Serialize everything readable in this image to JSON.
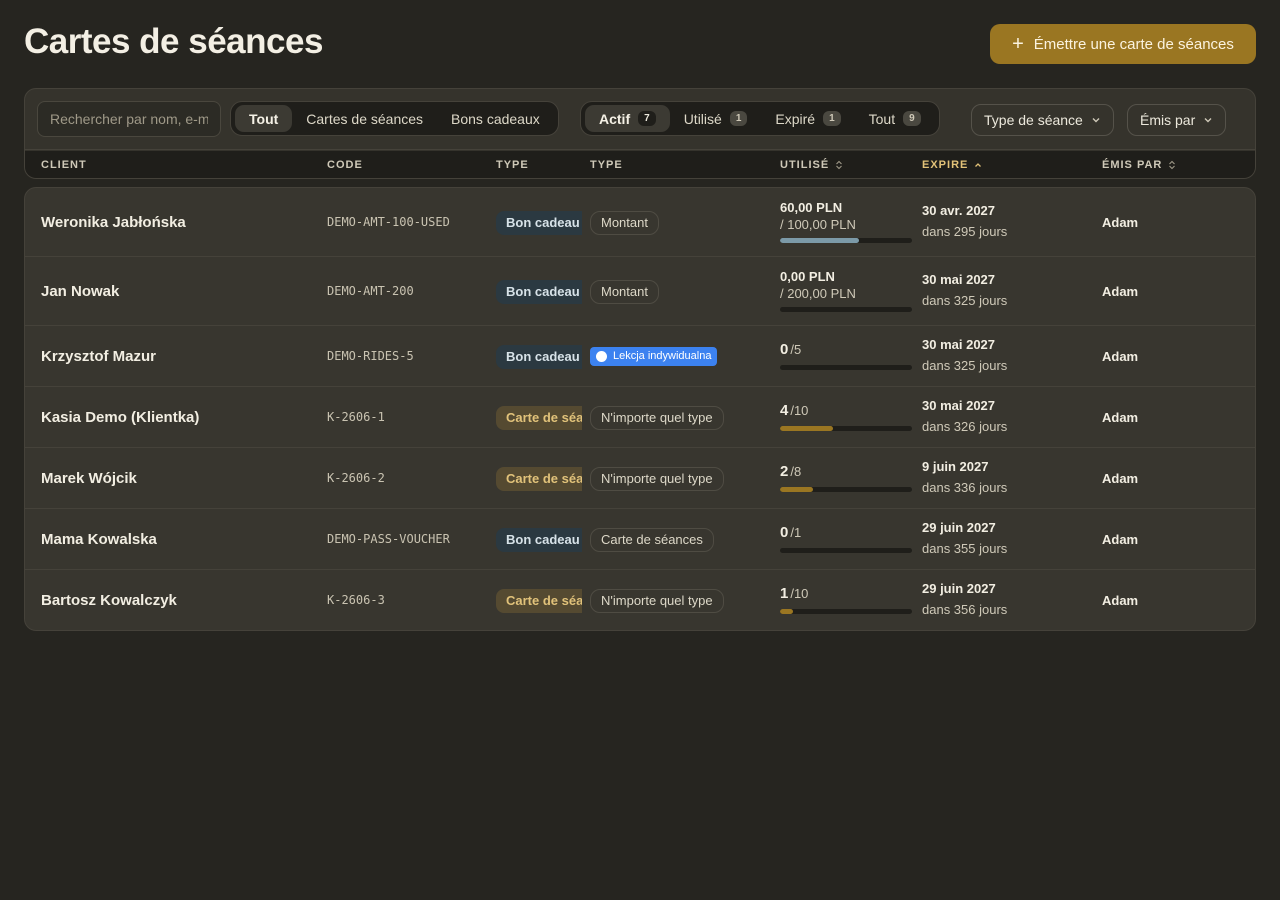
{
  "page": {
    "title": "Cartes de séances"
  },
  "actions": {
    "issue_label": "Émettre une carte de séances"
  },
  "toolbar": {
    "search_placeholder": "Rechercher par nom, e-mail ou code",
    "kind_filters": [
      {
        "label": "Tout",
        "active": true
      },
      {
        "label": "Cartes de séances",
        "active": false
      },
      {
        "label": "Bons cadeaux",
        "active": false
      }
    ],
    "status_filters": [
      {
        "label": "Actif",
        "count": "7",
        "active": true
      },
      {
        "label": "Utilisé",
        "count": "1",
        "active": false
      },
      {
        "label": "Expiré",
        "count": "1",
        "active": false
      },
      {
        "label": "Tout",
        "count": "9",
        "active": false
      }
    ],
    "session_type_dropdown": "Type de séance",
    "issued_by_dropdown": "Émis par"
  },
  "columns": {
    "client": "CLIENT",
    "code": "CODE",
    "type": "TYPE",
    "session_type": "TYPE",
    "used": "UTILISÉ",
    "expires": "EXPIRE",
    "issued_by": "ÉMIS PAR"
  },
  "colors": {
    "accent": "#9a7622",
    "bar_amount": "#7c9aa8",
    "bar_sessions": "#9a7622",
    "lesson": "#3c82f0"
  },
  "rows": [
    {
      "client": "Weronika Jabłońska",
      "code": "DEMO-AMT-100-USED",
      "kind": "gift",
      "type": "Bon cadeau",
      "session_type": "Montant",
      "session_style": "outline",
      "used_mode": "amount",
      "used_value": "60,00 PLN",
      "used_total": "/ 100,00 PLN",
      "progress": 0.6,
      "expires": "30 avr. 2027",
      "expires_rel": "dans 295 jours",
      "issuer": "Adam"
    },
    {
      "client": "Jan Nowak",
      "code": "DEMO-AMT-200",
      "kind": "gift",
      "type": "Bon cadeau",
      "session_type": "Montant",
      "session_style": "outline",
      "used_mode": "amount",
      "used_value": "0,00 PLN",
      "used_total": "/ 200,00 PLN",
      "progress": 0,
      "expires": "30 mai 2027",
      "expires_rel": "dans 325 jours",
      "issuer": "Adam"
    },
    {
      "client": "Krzysztof Mazur",
      "code": "DEMO-RIDES-5",
      "kind": "gift",
      "type": "Bon cadeau",
      "session_type": "Lekcja indywidualna",
      "session_style": "lesson",
      "used_mode": "count",
      "used_value": "0",
      "used_total": "/5",
      "progress": 0,
      "expires": "30 mai 2027",
      "expires_rel": "dans 325 jours",
      "issuer": "Adam"
    },
    {
      "client": "Kasia Demo (Klientka)",
      "code": "K-2606-1",
      "kind": "pass",
      "type": "Carte de séances",
      "session_type": "N'importe quel type",
      "session_style": "outline",
      "used_mode": "count",
      "used_value": "4",
      "used_total": "/10",
      "progress": 0.4,
      "expires": "30 mai 2027",
      "expires_rel": "dans 326 jours",
      "issuer": "Adam"
    },
    {
      "client": "Marek Wójcik",
      "code": "K-2606-2",
      "kind": "pass",
      "type": "Carte de séances",
      "session_type": "N'importe quel type",
      "session_style": "outline",
      "used_mode": "count",
      "used_value": "2",
      "used_total": "/8",
      "progress": 0.25,
      "expires": "9 juin 2027",
      "expires_rel": "dans 336 jours",
      "issuer": "Adam"
    },
    {
      "client": "Mama Kowalska",
      "code": "DEMO-PASS-VOUCHER",
      "kind": "gift",
      "type": "Bon cadeau",
      "session_type": "Carte de séances",
      "session_style": "outline",
      "used_mode": "count",
      "used_value": "0",
      "used_total": "/1",
      "progress": 0,
      "expires": "29 juin 2027",
      "expires_rel": "dans 355 jours",
      "issuer": "Adam"
    },
    {
      "client": "Bartosz Kowalczyk",
      "code": "K-2606-3",
      "kind": "pass",
      "type": "Carte de séances",
      "session_type": "N'importe quel type",
      "session_style": "outline",
      "used_mode": "count",
      "used_value": "1",
      "used_total": "/10",
      "progress": 0.1,
      "expires": "29 juin 2027",
      "expires_rel": "dans 356 jours",
      "issuer": "Adam"
    }
  ]
}
